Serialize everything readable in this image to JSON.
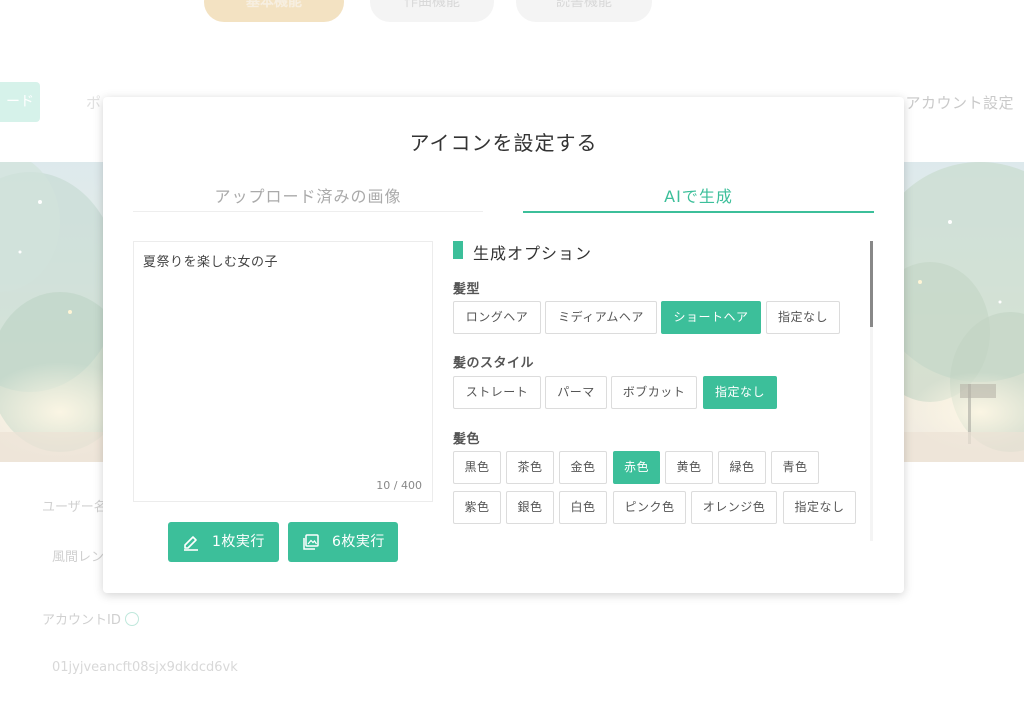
{
  "background": {
    "top_tabs": [
      "基本機能",
      "作曲機能",
      "読書機能"
    ],
    "nav_left": "ポ",
    "nav_right": "アカウント設定",
    "nav_green_label": "ード",
    "user_label": "ユーザー名",
    "name_value": "風間レン",
    "account_id_label": "アカウントID",
    "account_id_value": "01jyjveancft08sjx9dkdcd6vk"
  },
  "modal": {
    "title": "アイコンを設定する",
    "tabs": {
      "uploaded": "アップロード済みの画像",
      "ai": "AIで生成"
    },
    "prompt": {
      "value": "夏祭りを楽しむ女の子",
      "count": "10 / 400"
    },
    "buttons": {
      "one": "1枚実行",
      "six": "6枚実行"
    },
    "options": {
      "title": "生成オプション",
      "hair_type": {
        "label": "髪型",
        "options": [
          "ロングヘア",
          "ミディアムヘア",
          "ショートヘア",
          "指定なし"
        ],
        "selected": "ショートヘア"
      },
      "hair_style": {
        "label": "髪のスタイル",
        "options": [
          "ストレート",
          "パーマ",
          "ボブカット",
          "指定なし"
        ],
        "selected": "指定なし"
      },
      "hair_color": {
        "label": "髪色",
        "options": [
          "黒色",
          "茶色",
          "金色",
          "赤色",
          "黄色",
          "緑色",
          "青色",
          "紫色",
          "銀色",
          "白色",
          "ピンク色",
          "オレンジ色",
          "指定なし"
        ],
        "selected": "赤色"
      }
    }
  },
  "colors": {
    "accent": "#3cbf9a",
    "top_tab_active": "#f3e2c2"
  }
}
